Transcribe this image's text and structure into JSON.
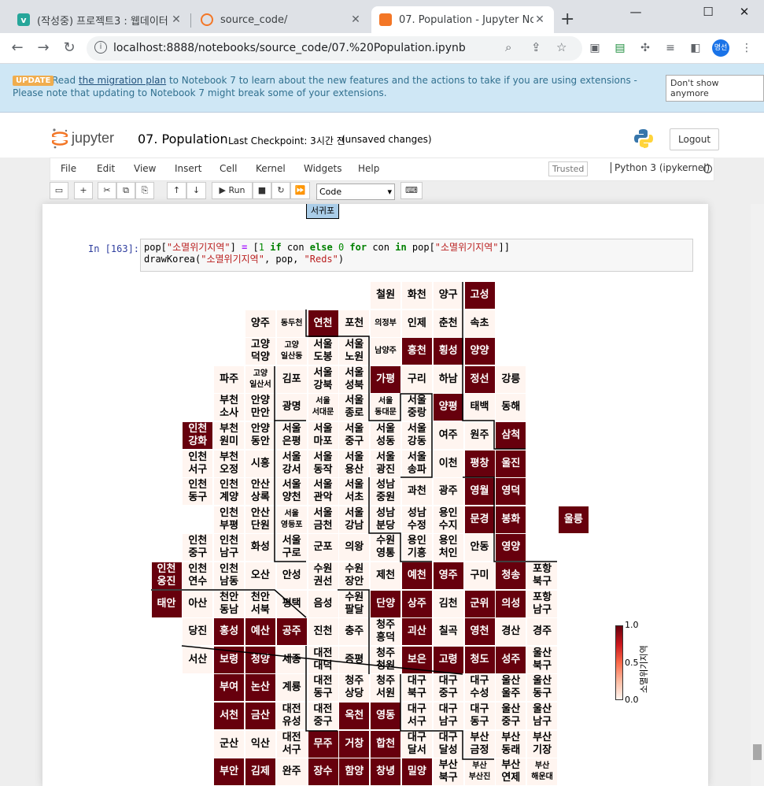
{
  "tabs": [
    {
      "title": "(작성중) 프로젝트3 : 웹데이터",
      "icon": "v-icon",
      "color": "#26a69a"
    },
    {
      "title": "source_code/",
      "icon": "jupyter-icon",
      "color": "#f37626"
    },
    {
      "title": "07. Population - Jupyter Notel",
      "icon": "jupyter-icon",
      "color": "#f37626"
    }
  ],
  "browser": {
    "url": "localhost:8888/notebooks/source_code/07.%20Population.ipynb",
    "profile": "명선"
  },
  "banner": {
    "badge": "UPDATE",
    "pre": "Read ",
    "link": "the migration plan",
    "post": " to Notebook 7 to learn about the new features and the actions to take if you are using extensions - Please note that updating to Notebook 7 might break some of your extensions.",
    "dismiss": "Don't show anymore"
  },
  "notebook": {
    "name": "07. Population",
    "checkpoint": "Last Checkpoint: 3시간 전",
    "status": "(unsaved changes)",
    "logout": "Logout",
    "trusted": "Trusted",
    "kernel": "Python 3 (ipykernel)",
    "celltype": "Code",
    "run": "Run",
    "logo_text": "jupyter"
  },
  "menu": [
    "File",
    "Edit",
    "View",
    "Insert",
    "Cell",
    "Kernel",
    "Widgets",
    "Help"
  ],
  "prev_output": "서귀포",
  "cell": {
    "prompt": "In [163]:"
  },
  "colorbar": {
    "label": "소멸위기지역",
    "ticks": [
      "1.0",
      "0.5",
      "0.0"
    ],
    "colors": {
      "high": "#67000d",
      "low": "#fff5f0"
    }
  },
  "map_cells": [
    {
      "c": 11,
      "r": 0,
      "t": "철원",
      "h": 0
    },
    {
      "c": 12,
      "r": 0,
      "t": "화천",
      "h": 0
    },
    {
      "c": 13,
      "r": 0,
      "t": "양구",
      "h": 0
    },
    {
      "c": 14,
      "r": 0,
      "t": "고성",
      "h": 1
    },
    {
      "c": 7,
      "r": 1,
      "t": "양주",
      "h": 0
    },
    {
      "c": 8,
      "r": 1,
      "t": "동두천",
      "h": 0,
      "s": 1
    },
    {
      "c": 9,
      "r": 1,
      "t": "연천",
      "h": 1
    },
    {
      "c": 10,
      "r": 1,
      "t": "포천",
      "h": 0
    },
    {
      "c": 11,
      "r": 1,
      "t": "의정부",
      "h": 0,
      "s": 1
    },
    {
      "c": 12,
      "r": 1,
      "t": "인제",
      "h": 0
    },
    {
      "c": 13,
      "r": 1,
      "t": "춘천",
      "h": 0
    },
    {
      "c": 14,
      "r": 1,
      "t": "속초",
      "h": 0
    },
    {
      "c": 7,
      "r": 2,
      "t": "고양\n덕양",
      "h": 0
    },
    {
      "c": 8,
      "r": 2,
      "t": "고양\n일산동",
      "h": 0,
      "s": 1
    },
    {
      "c": 9,
      "r": 2,
      "t": "서울\n도봉",
      "h": 0
    },
    {
      "c": 10,
      "r": 2,
      "t": "서울\n노원",
      "h": 0
    },
    {
      "c": 11,
      "r": 2,
      "t": "남양주",
      "h": 0,
      "s": 1
    },
    {
      "c": 12,
      "r": 2,
      "t": "홍천",
      "h": 1
    },
    {
      "c": 13,
      "r": 2,
      "t": "횡성",
      "h": 1
    },
    {
      "c": 14,
      "r": 2,
      "t": "양양",
      "h": 1
    },
    {
      "c": 6,
      "r": 3,
      "t": "파주",
      "h": 0
    },
    {
      "c": 7,
      "r": 3,
      "t": "고양\n일산서",
      "h": 0,
      "s": 1
    },
    {
      "c": 8,
      "r": 3,
      "t": "김포",
      "h": 0
    },
    {
      "c": 9,
      "r": 3,
      "t": "서울\n강북",
      "h": 0
    },
    {
      "c": 10,
      "r": 3,
      "t": "서울\n성북",
      "h": 0
    },
    {
      "c": 11,
      "r": 3,
      "t": "가평",
      "h": 1
    },
    {
      "c": 12,
      "r": 3,
      "t": "구리",
      "h": 0
    },
    {
      "c": 13,
      "r": 3,
      "t": "하남",
      "h": 0
    },
    {
      "c": 14,
      "r": 3,
      "t": "정선",
      "h": 1
    },
    {
      "c": 15,
      "r": 3,
      "t": "강릉",
      "h": 0
    },
    {
      "c": 6,
      "r": 4,
      "t": "부천\n소사",
      "h": 0
    },
    {
      "c": 7,
      "r": 4,
      "t": "안양\n만안",
      "h": 0
    },
    {
      "c": 8,
      "r": 4,
      "t": "광명",
      "h": 0
    },
    {
      "c": 9,
      "r": 4,
      "t": "서울\n서대문",
      "h": 0,
      "s": 1
    },
    {
      "c": 10,
      "r": 4,
      "t": "서울\n종로",
      "h": 0
    },
    {
      "c": 11,
      "r": 4,
      "t": "서울\n동대문",
      "h": 0,
      "s": 1
    },
    {
      "c": 12,
      "r": 4,
      "t": "서울\n중랑",
      "h": 0
    },
    {
      "c": 13,
      "r": 4,
      "t": "양평",
      "h": 1
    },
    {
      "c": 14,
      "r": 4,
      "t": "태백",
      "h": 0
    },
    {
      "c": 15,
      "r": 4,
      "t": "동해",
      "h": 0
    },
    {
      "c": 5,
      "r": 5,
      "t": "인천\n강화",
      "h": 1
    },
    {
      "c": 6,
      "r": 5,
      "t": "부천\n원미",
      "h": 0
    },
    {
      "c": 7,
      "r": 5,
      "t": "안양\n동안",
      "h": 0
    },
    {
      "c": 8,
      "r": 5,
      "t": "서울\n은평",
      "h": 0
    },
    {
      "c": 9,
      "r": 5,
      "t": "서울\n마포",
      "h": 0
    },
    {
      "c": 10,
      "r": 5,
      "t": "서울\n중구",
      "h": 0
    },
    {
      "c": 11,
      "r": 5,
      "t": "서울\n성동",
      "h": 0
    },
    {
      "c": 12,
      "r": 5,
      "t": "서울\n강동",
      "h": 0
    },
    {
      "c": 13,
      "r": 5,
      "t": "여주",
      "h": 0
    },
    {
      "c": 14,
      "r": 5,
      "t": "원주",
      "h": 0
    },
    {
      "c": 15,
      "r": 5,
      "t": "삼척",
      "h": 1
    },
    {
      "c": 5,
      "r": 6,
      "t": "인천\n서구",
      "h": 0
    },
    {
      "c": 6,
      "r": 6,
      "t": "부천\n오정",
      "h": 0
    },
    {
      "c": 7,
      "r": 6,
      "t": "시흥",
      "h": 0
    },
    {
      "c": 8,
      "r": 6,
      "t": "서울\n강서",
      "h": 0
    },
    {
      "c": 9,
      "r": 6,
      "t": "서울\n동작",
      "h": 0
    },
    {
      "c": 10,
      "r": 6,
      "t": "서울\n용산",
      "h": 0
    },
    {
      "c": 11,
      "r": 6,
      "t": "서울\n광진",
      "h": 0
    },
    {
      "c": 12,
      "r": 6,
      "t": "서울\n송파",
      "h": 0
    },
    {
      "c": 13,
      "r": 6,
      "t": "이천",
      "h": 0
    },
    {
      "c": 14,
      "r": 6,
      "t": "평창",
      "h": 1
    },
    {
      "c": 15,
      "r": 6,
      "t": "울진",
      "h": 1
    },
    {
      "c": 5,
      "r": 7,
      "t": "인천\n동구",
      "h": 0
    },
    {
      "c": 6,
      "r": 7,
      "t": "인천\n계양",
      "h": 0
    },
    {
      "c": 7,
      "r": 7,
      "t": "안산\n상록",
      "h": 0
    },
    {
      "c": 8,
      "r": 7,
      "t": "서울\n양천",
      "h": 0
    },
    {
      "c": 9,
      "r": 7,
      "t": "서울\n관악",
      "h": 0
    },
    {
      "c": 10,
      "r": 7,
      "t": "서울\n서초",
      "h": 0
    },
    {
      "c": 11,
      "r": 7,
      "t": "성남\n중원",
      "h": 0
    },
    {
      "c": 12,
      "r": 7,
      "t": "과천",
      "h": 0
    },
    {
      "c": 13,
      "r": 7,
      "t": "광주",
      "h": 0
    },
    {
      "c": 14,
      "r": 7,
      "t": "영월",
      "h": 1
    },
    {
      "c": 15,
      "r": 7,
      "t": "영덕",
      "h": 1
    },
    {
      "c": 6,
      "r": 8,
      "t": "인천\n부평",
      "h": 0
    },
    {
      "c": 7,
      "r": 8,
      "t": "안산\n단원",
      "h": 0
    },
    {
      "c": 8,
      "r": 8,
      "t": "서울\n영등포",
      "h": 0,
      "s": 1
    },
    {
      "c": 9,
      "r": 8,
      "t": "서울\n금천",
      "h": 0
    },
    {
      "c": 10,
      "r": 8,
      "t": "서울\n강남",
      "h": 0
    },
    {
      "c": 11,
      "r": 8,
      "t": "성남\n분당",
      "h": 0
    },
    {
      "c": 12,
      "r": 8,
      "t": "성남\n수정",
      "h": 0
    },
    {
      "c": 13,
      "r": 8,
      "t": "용인\n수지",
      "h": 0
    },
    {
      "c": 14,
      "r": 8,
      "t": "문경",
      "h": 1
    },
    {
      "c": 15,
      "r": 8,
      "t": "봉화",
      "h": 1
    },
    {
      "c": 17,
      "r": 8,
      "t": "울릉",
      "h": 1
    },
    {
      "c": 5,
      "r": 9,
      "t": "인천\n중구",
      "h": 0
    },
    {
      "c": 6,
      "r": 9,
      "t": "인천\n남구",
      "h": 0
    },
    {
      "c": 7,
      "r": 9,
      "t": "화성",
      "h": 0
    },
    {
      "c": 8,
      "r": 9,
      "t": "서울\n구로",
      "h": 0
    },
    {
      "c": 9,
      "r": 9,
      "t": "군포",
      "h": 0
    },
    {
      "c": 10,
      "r": 9,
      "t": "의왕",
      "h": 0
    },
    {
      "c": 11,
      "r": 9,
      "t": "수원\n영통",
      "h": 0
    },
    {
      "c": 12,
      "r": 9,
      "t": "용인\n기흥",
      "h": 0
    },
    {
      "c": 13,
      "r": 9,
      "t": "용인\n처인",
      "h": 0
    },
    {
      "c": 14,
      "r": 9,
      "t": "안동",
      "h": 0
    },
    {
      "c": 15,
      "r": 9,
      "t": "영양",
      "h": 1
    },
    {
      "c": 4,
      "r": 10,
      "t": "인천\n옹진",
      "h": 1
    },
    {
      "c": 5,
      "r": 10,
      "t": "인천\n연수",
      "h": 0
    },
    {
      "c": 6,
      "r": 10,
      "t": "인천\n남동",
      "h": 0
    },
    {
      "c": 7,
      "r": 10,
      "t": "오산",
      "h": 0
    },
    {
      "c": 8,
      "r": 10,
      "t": "안성",
      "h": 0
    },
    {
      "c": 9,
      "r": 10,
      "t": "수원\n권선",
      "h": 0
    },
    {
      "c": 10,
      "r": 10,
      "t": "수원\n장안",
      "h": 0
    },
    {
      "c": 11,
      "r": 10,
      "t": "제천",
      "h": 0
    },
    {
      "c": 12,
      "r": 10,
      "t": "예천",
      "h": 1
    },
    {
      "c": 13,
      "r": 10,
      "t": "영주",
      "h": 1
    },
    {
      "c": 14,
      "r": 10,
      "t": "구미",
      "h": 0
    },
    {
      "c": 15,
      "r": 10,
      "t": "청송",
      "h": 1
    },
    {
      "c": 16,
      "r": 10,
      "t": "포항\n북구",
      "h": 0
    },
    {
      "c": 4,
      "r": 11,
      "t": "태안",
      "h": 1
    },
    {
      "c": 5,
      "r": 11,
      "t": "아산",
      "h": 0
    },
    {
      "c": 6,
      "r": 11,
      "t": "천안\n동남",
      "h": 0
    },
    {
      "c": 7,
      "r": 11,
      "t": "천안\n서북",
      "h": 0
    },
    {
      "c": 8,
      "r": 11,
      "t": "평택",
      "h": 0
    },
    {
      "c": 9,
      "r": 11,
      "t": "음성",
      "h": 0
    },
    {
      "c": 10,
      "r": 11,
      "t": "수원\n팔달",
      "h": 0
    },
    {
      "c": 11,
      "r": 11,
      "t": "단양",
      "h": 1
    },
    {
      "c": 12,
      "r": 11,
      "t": "상주",
      "h": 1
    },
    {
      "c": 13,
      "r": 11,
      "t": "김천",
      "h": 0
    },
    {
      "c": 14,
      "r": 11,
      "t": "군위",
      "h": 1
    },
    {
      "c": 15,
      "r": 11,
      "t": "의성",
      "h": 1
    },
    {
      "c": 16,
      "r": 11,
      "t": "포항\n남구",
      "h": 0
    },
    {
      "c": 5,
      "r": 12,
      "t": "당진",
      "h": 0
    },
    {
      "c": 6,
      "r": 12,
      "t": "홍성",
      "h": 1
    },
    {
      "c": 7,
      "r": 12,
      "t": "예산",
      "h": 1
    },
    {
      "c": 8,
      "r": 12,
      "t": "공주",
      "h": 1
    },
    {
      "c": 9,
      "r": 12,
      "t": "진천",
      "h": 0
    },
    {
      "c": 10,
      "r": 12,
      "t": "충주",
      "h": 0
    },
    {
      "c": 11,
      "r": 12,
      "t": "청주\n흥덕",
      "h": 0
    },
    {
      "c": 12,
      "r": 12,
      "t": "괴산",
      "h": 1
    },
    {
      "c": 13,
      "r": 12,
      "t": "칠곡",
      "h": 0
    },
    {
      "c": 14,
      "r": 12,
      "t": "영천",
      "h": 1
    },
    {
      "c": 15,
      "r": 12,
      "t": "경산",
      "h": 0
    },
    {
      "c": 16,
      "r": 12,
      "t": "경주",
      "h": 0
    },
    {
      "c": 5,
      "r": 13,
      "t": "서산",
      "h": 0
    },
    {
      "c": 6,
      "r": 13,
      "t": "보령",
      "h": 1
    },
    {
      "c": 7,
      "r": 13,
      "t": "청양",
      "h": 1
    },
    {
      "c": 8,
      "r": 13,
      "t": "세종",
      "h": 0
    },
    {
      "c": 9,
      "r": 13,
      "t": "대전\n대덕",
      "h": 0
    },
    {
      "c": 10,
      "r": 13,
      "t": "증평",
      "h": 0
    },
    {
      "c": 11,
      "r": 13,
      "t": "청주\n청원",
      "h": 0
    },
    {
      "c": 12,
      "r": 13,
      "t": "보은",
      "h": 1
    },
    {
      "c": 13,
      "r": 13,
      "t": "고령",
      "h": 1
    },
    {
      "c": 14,
      "r": 13,
      "t": "청도",
      "h": 1
    },
    {
      "c": 15,
      "r": 13,
      "t": "성주",
      "h": 1
    },
    {
      "c": 16,
      "r": 13,
      "t": "울산\n북구",
      "h": 0
    },
    {
      "c": 6,
      "r": 14,
      "t": "부여",
      "h": 1
    },
    {
      "c": 7,
      "r": 14,
      "t": "논산",
      "h": 1
    },
    {
      "c": 8,
      "r": 14,
      "t": "계룡",
      "h": 0
    },
    {
      "c": 9,
      "r": 14,
      "t": "대전\n동구",
      "h": 0
    },
    {
      "c": 10,
      "r": 14,
      "t": "청주\n상당",
      "h": 0
    },
    {
      "c": 11,
      "r": 14,
      "t": "청주\n서원",
      "h": 0
    },
    {
      "c": 12,
      "r": 14,
      "t": "대구\n북구",
      "h": 0
    },
    {
      "c": 13,
      "r": 14,
      "t": "대구\n중구",
      "h": 0
    },
    {
      "c": 14,
      "r": 14,
      "t": "대구\n수성",
      "h": 0
    },
    {
      "c": 15,
      "r": 14,
      "t": "울산\n울주",
      "h": 0
    },
    {
      "c": 16,
      "r": 14,
      "t": "울산\n동구",
      "h": 0
    },
    {
      "c": 6,
      "r": 15,
      "t": "서천",
      "h": 1
    },
    {
      "c": 7,
      "r": 15,
      "t": "금산",
      "h": 1
    },
    {
      "c": 8,
      "r": 15,
      "t": "대전\n유성",
      "h": 0
    },
    {
      "c": 9,
      "r": 15,
      "t": "대전\n중구",
      "h": 0
    },
    {
      "c": 10,
      "r": 15,
      "t": "옥천",
      "h": 1
    },
    {
      "c": 11,
      "r": 15,
      "t": "영동",
      "h": 1
    },
    {
      "c": 12,
      "r": 15,
      "t": "대구\n서구",
      "h": 0
    },
    {
      "c": 13,
      "r": 15,
      "t": "대구\n남구",
      "h": 0
    },
    {
      "c": 14,
      "r": 15,
      "t": "대구\n동구",
      "h": 0
    },
    {
      "c": 15,
      "r": 15,
      "t": "울산\n중구",
      "h": 0
    },
    {
      "c": 16,
      "r": 15,
      "t": "울산\n남구",
      "h": 0
    },
    {
      "c": 6,
      "r": 16,
      "t": "군산",
      "h": 0
    },
    {
      "c": 7,
      "r": 16,
      "t": "익산",
      "h": 0
    },
    {
      "c": 8,
      "r": 16,
      "t": "대전\n서구",
      "h": 0
    },
    {
      "c": 9,
      "r": 16,
      "t": "무주",
      "h": 1
    },
    {
      "c": 10,
      "r": 16,
      "t": "거창",
      "h": 1
    },
    {
      "c": 11,
      "r": 16,
      "t": "합천",
      "h": 1
    },
    {
      "c": 12,
      "r": 16,
      "t": "대구\n달서",
      "h": 0
    },
    {
      "c": 13,
      "r": 16,
      "t": "대구\n달성",
      "h": 0
    },
    {
      "c": 14,
      "r": 16,
      "t": "부산\n금정",
      "h": 0
    },
    {
      "c": 15,
      "r": 16,
      "t": "부산\n동래",
      "h": 0
    },
    {
      "c": 16,
      "r": 16,
      "t": "부산\n기장",
      "h": 0
    },
    {
      "c": 6,
      "r": 17,
      "t": "부안",
      "h": 1
    },
    {
      "c": 7,
      "r": 17,
      "t": "김제",
      "h": 1
    },
    {
      "c": 8,
      "r": 17,
      "t": "완주",
      "h": 0
    },
    {
      "c": 9,
      "r": 17,
      "t": "장수",
      "h": 1
    },
    {
      "c": 10,
      "r": 17,
      "t": "함양",
      "h": 1
    },
    {
      "c": 11,
      "r": 17,
      "t": "창녕",
      "h": 1
    },
    {
      "c": 12,
      "r": 17,
      "t": "밀양",
      "h": 1
    },
    {
      "c": 13,
      "r": 17,
      "t": "부산\n북구",
      "h": 0
    },
    {
      "c": 14,
      "r": 17,
      "t": "부산\n부산진",
      "h": 0,
      "s": 1
    },
    {
      "c": 15,
      "r": 17,
      "t": "부산\n연제",
      "h": 0
    },
    {
      "c": 16,
      "r": 17,
      "t": "부산\n해운대",
      "h": 0,
      "s": 1
    }
  ]
}
